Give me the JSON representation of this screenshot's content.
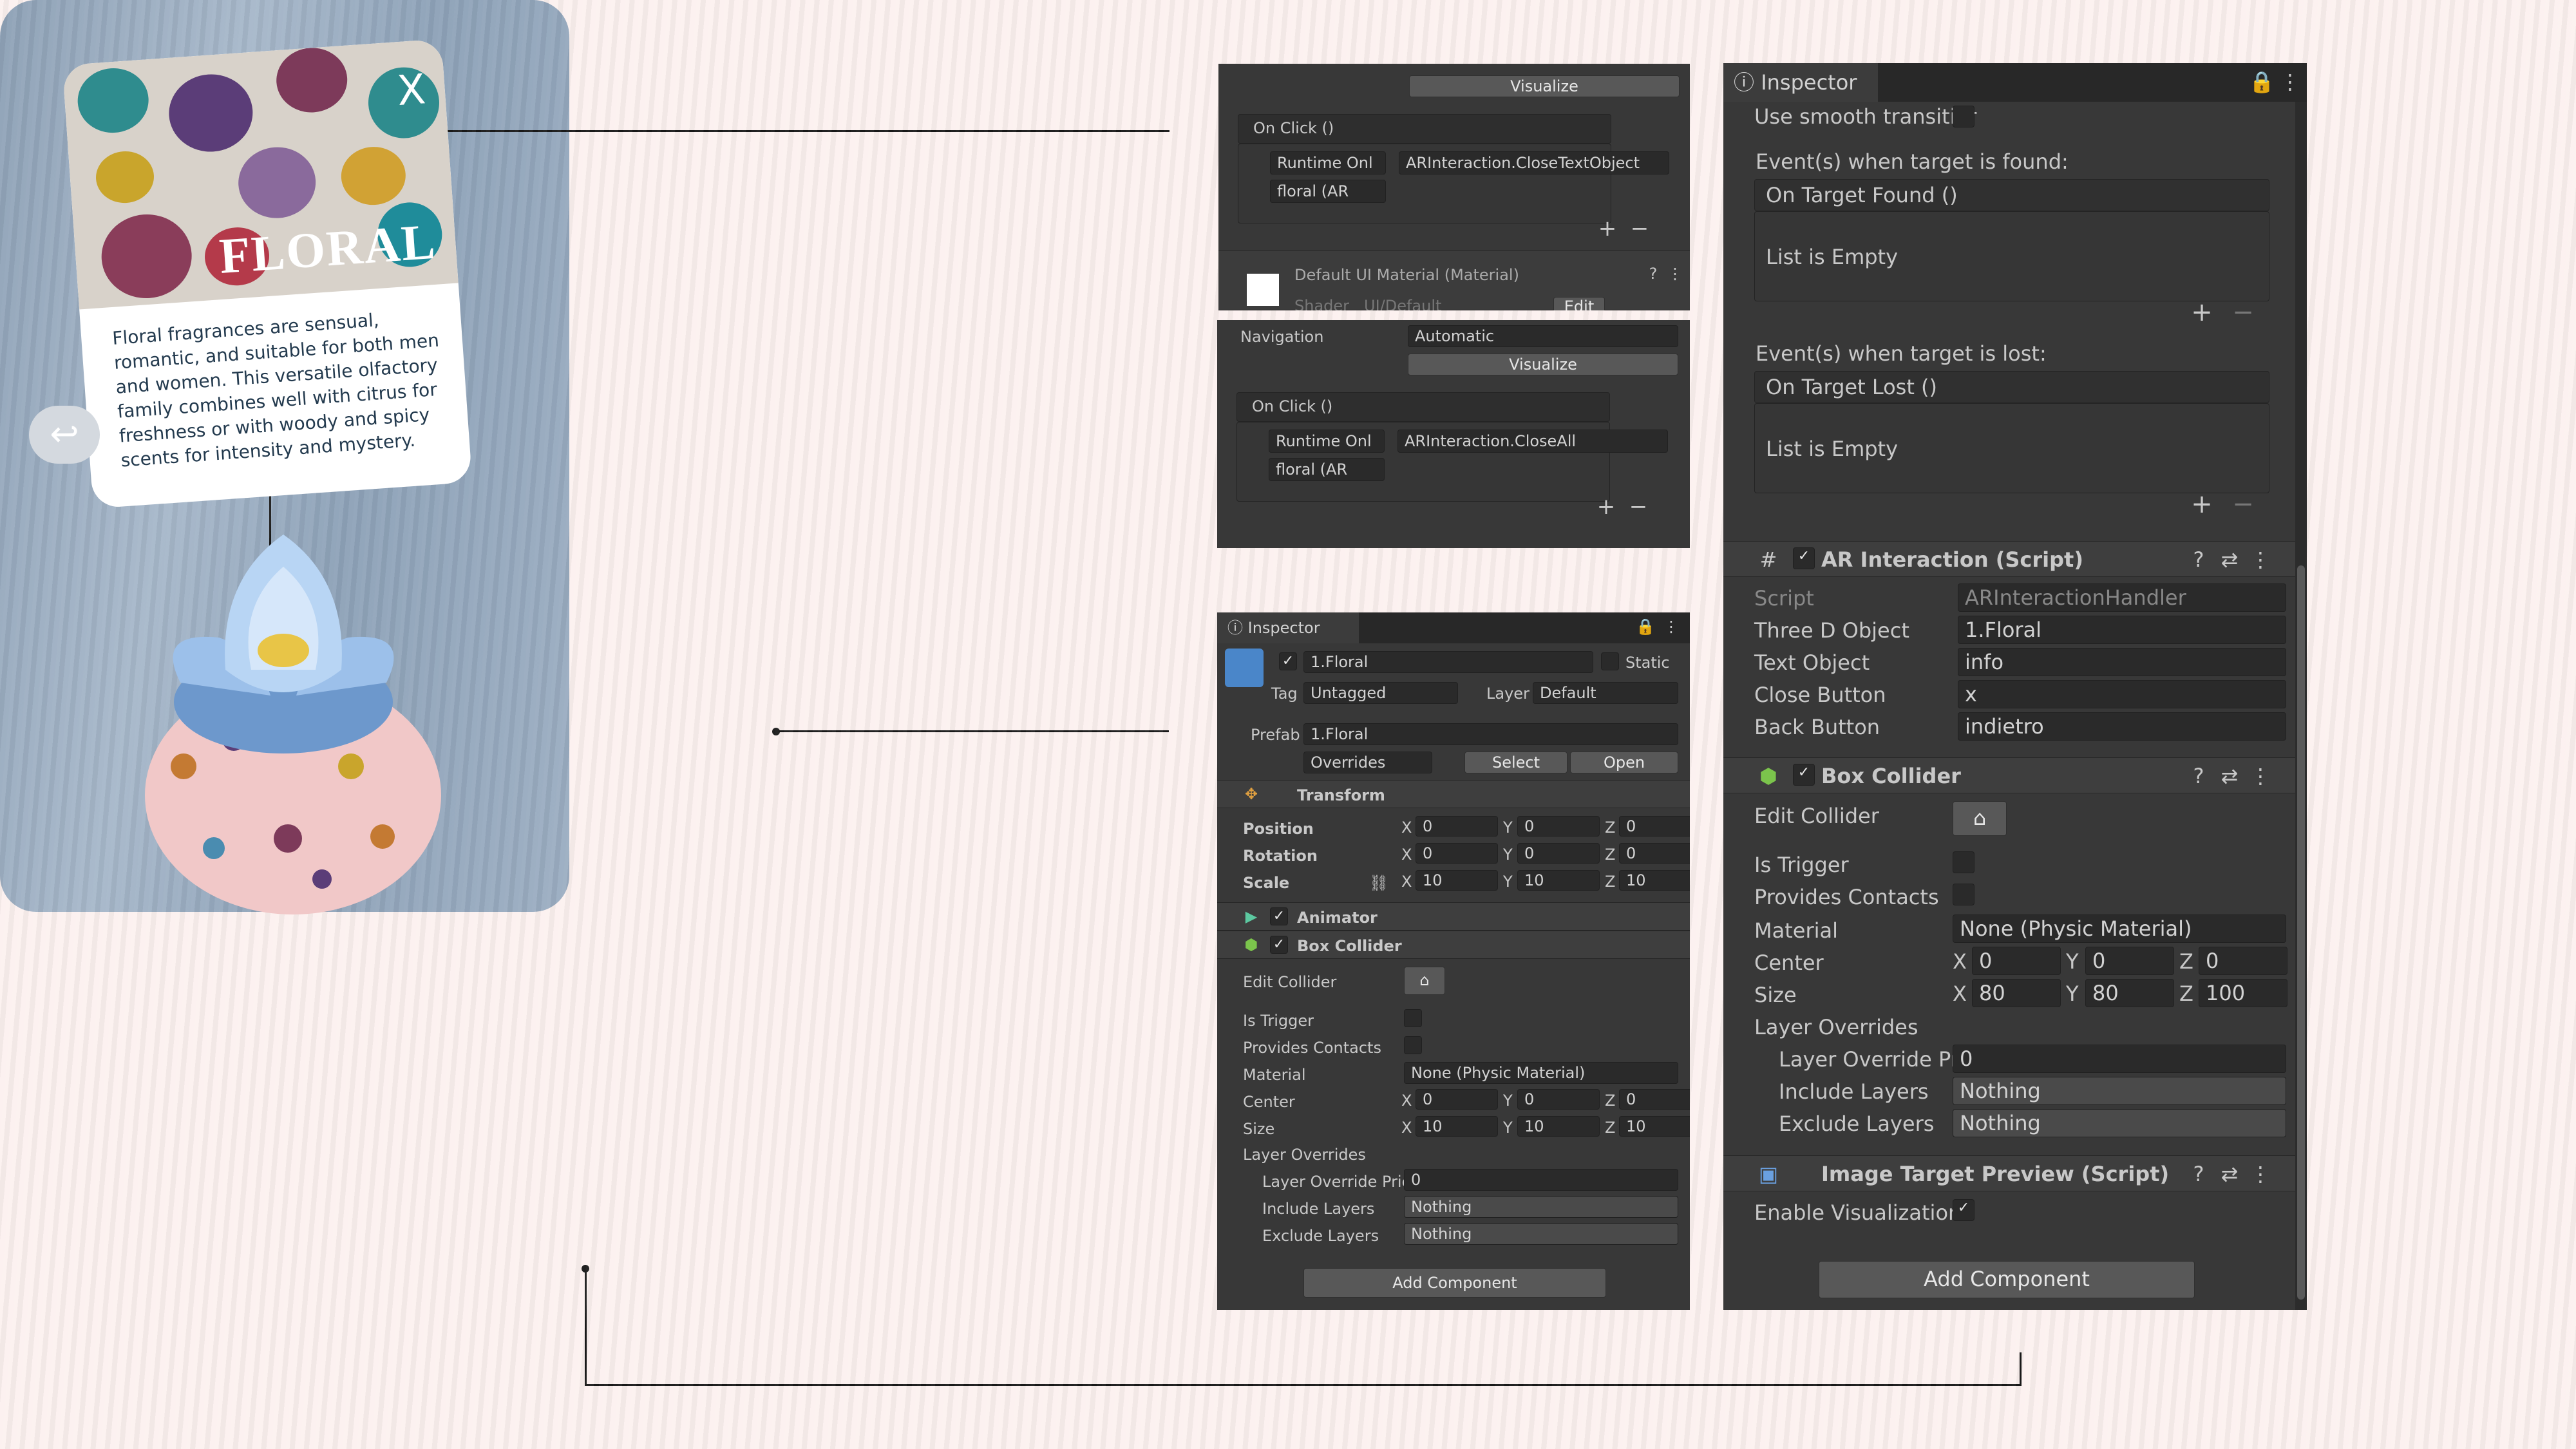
{
  "phone": {
    "title": "FLORAL",
    "close": "X",
    "back": "↩",
    "description": "Floral fragrances are sensual, romantic, and suitable for both men and women. This versatile olfactory family combines well with citrus for freshness or with woody and spicy scents for intensity and mystery."
  },
  "p1": {
    "visualize": "Visualize",
    "on_click": "On Click ()",
    "runtime": "Runtime Onl",
    "function": "ARInteraction.CloseTextObject",
    "object": "floral (AR",
    "material": "Default UI Material (Material)",
    "shader_label": "Shader",
    "shader": "UI/Default",
    "edit": "Edit"
  },
  "p2": {
    "navigation_label": "Navigation",
    "navigation": "Automatic",
    "visualize": "Visualize",
    "on_click": "On Click ()",
    "runtime": "Runtime Onl",
    "function": "ARInteraction.CloseAll",
    "object": "floral (AR"
  },
  "p3": {
    "tab": "Inspector",
    "name": "1.Floral",
    "static": "Static",
    "tag_label": "Tag",
    "tag": "Untagged",
    "layer_label": "Layer",
    "layer": "Default",
    "prefab_label": "Prefab",
    "prefab": "1.Floral",
    "overrides": "Overrides",
    "select": "Select",
    "open": "Open",
    "transform": "Transform",
    "position": "Position",
    "rotation": "Rotation",
    "scale": "Scale",
    "pos": [
      "0",
      "0",
      "0"
    ],
    "rot": [
      "0",
      "0",
      "0"
    ],
    "scl": [
      "10",
      "10",
      "10"
    ],
    "animator": "Animator",
    "box_collider": "Box Collider",
    "edit_collider": "Edit Collider",
    "is_trigger": "Is Trigger",
    "provides_contacts": "Provides Contacts",
    "material_label": "Material",
    "material": "None (Physic Material)",
    "center": "Center",
    "size": "Size",
    "ctr": [
      "0",
      "0",
      "0"
    ],
    "sz": [
      "10",
      "10",
      "10"
    ],
    "layer_overrides": "Layer Overrides",
    "layer_override_priority": "Layer Override Pric",
    "priority": "0",
    "include_layers": "Include Layers",
    "exclude_layers": "Exclude Layers",
    "nothing": "Nothing",
    "add_component": "Add Component"
  },
  "p4": {
    "tab": "Inspector",
    "smooth": "Use smooth transitior",
    "found_label": "Event(s) when target is found:",
    "on_found": "On Target Found ()",
    "empty": "List is Empty",
    "lost_label": "Event(s) when target is lost:",
    "on_lost": "On Target Lost ()",
    "ar_script": "AR Interaction (Script)",
    "script_label": "Script",
    "script": "ARInteractionHandler",
    "three_d_label": "Three D Object",
    "three_d": "1.Floral",
    "text_label": "Text Object",
    "text": "info",
    "close_label": "Close Button",
    "close": "x",
    "back_label": "Back Button",
    "back": "indietro",
    "box_collider": "Box Collider",
    "edit_collider": "Edit Collider",
    "is_trigger": "Is Trigger",
    "provides_contacts": "Provides Contacts",
    "material_label": "Material",
    "material": "None (Physic Material)",
    "center": "Center",
    "size": "Size",
    "ctr": [
      "0",
      "0",
      "0"
    ],
    "sz": [
      "80",
      "80",
      "100"
    ],
    "layer_overrides": "Layer Overrides",
    "layer_override_priority": "Layer Override Pric",
    "priority": "0",
    "include_layers": "Include Layers",
    "exclude_layers": "Exclude Layers",
    "nothing": "Nothing",
    "image_target": "Image Target Preview (Script)",
    "enable_vis": "Enable Visualization",
    "add_component": "Add Component"
  },
  "axes": {
    "x": "X",
    "y": "Y",
    "z": "Z"
  },
  "colors": {
    "background": "#fcf1ef",
    "panel": "#383838",
    "accent": "#3a79d1"
  }
}
